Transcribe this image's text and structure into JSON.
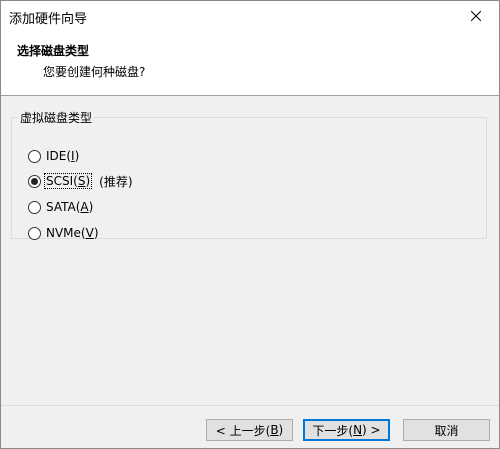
{
  "window": {
    "title": "添加硬件向导"
  },
  "header": {
    "title": "选择磁盘类型",
    "subtitle": "您要创建何种磁盘?"
  },
  "group": {
    "legend": "虚拟磁盘类型",
    "options": [
      {
        "label": "IDE(",
        "mnemonic": "I",
        "suffix": ")",
        "hint": "",
        "checked": false
      },
      {
        "label": "SCSI(",
        "mnemonic": "S",
        "suffix": ")",
        "hint": "(推荐)",
        "checked": true
      },
      {
        "label": "SATA(",
        "mnemonic": "A",
        "suffix": ")",
        "hint": "",
        "checked": false
      },
      {
        "label": "NVMe(",
        "mnemonic": "V",
        "suffix": ")",
        "hint": "",
        "checked": false
      }
    ]
  },
  "buttons": {
    "back": {
      "pre": "< 上一步(",
      "mnemonic": "B",
      "post": ")"
    },
    "next": {
      "pre": "下一步(",
      "mnemonic": "N",
      "post": ") >"
    },
    "cancel": {
      "label": "取消"
    }
  }
}
